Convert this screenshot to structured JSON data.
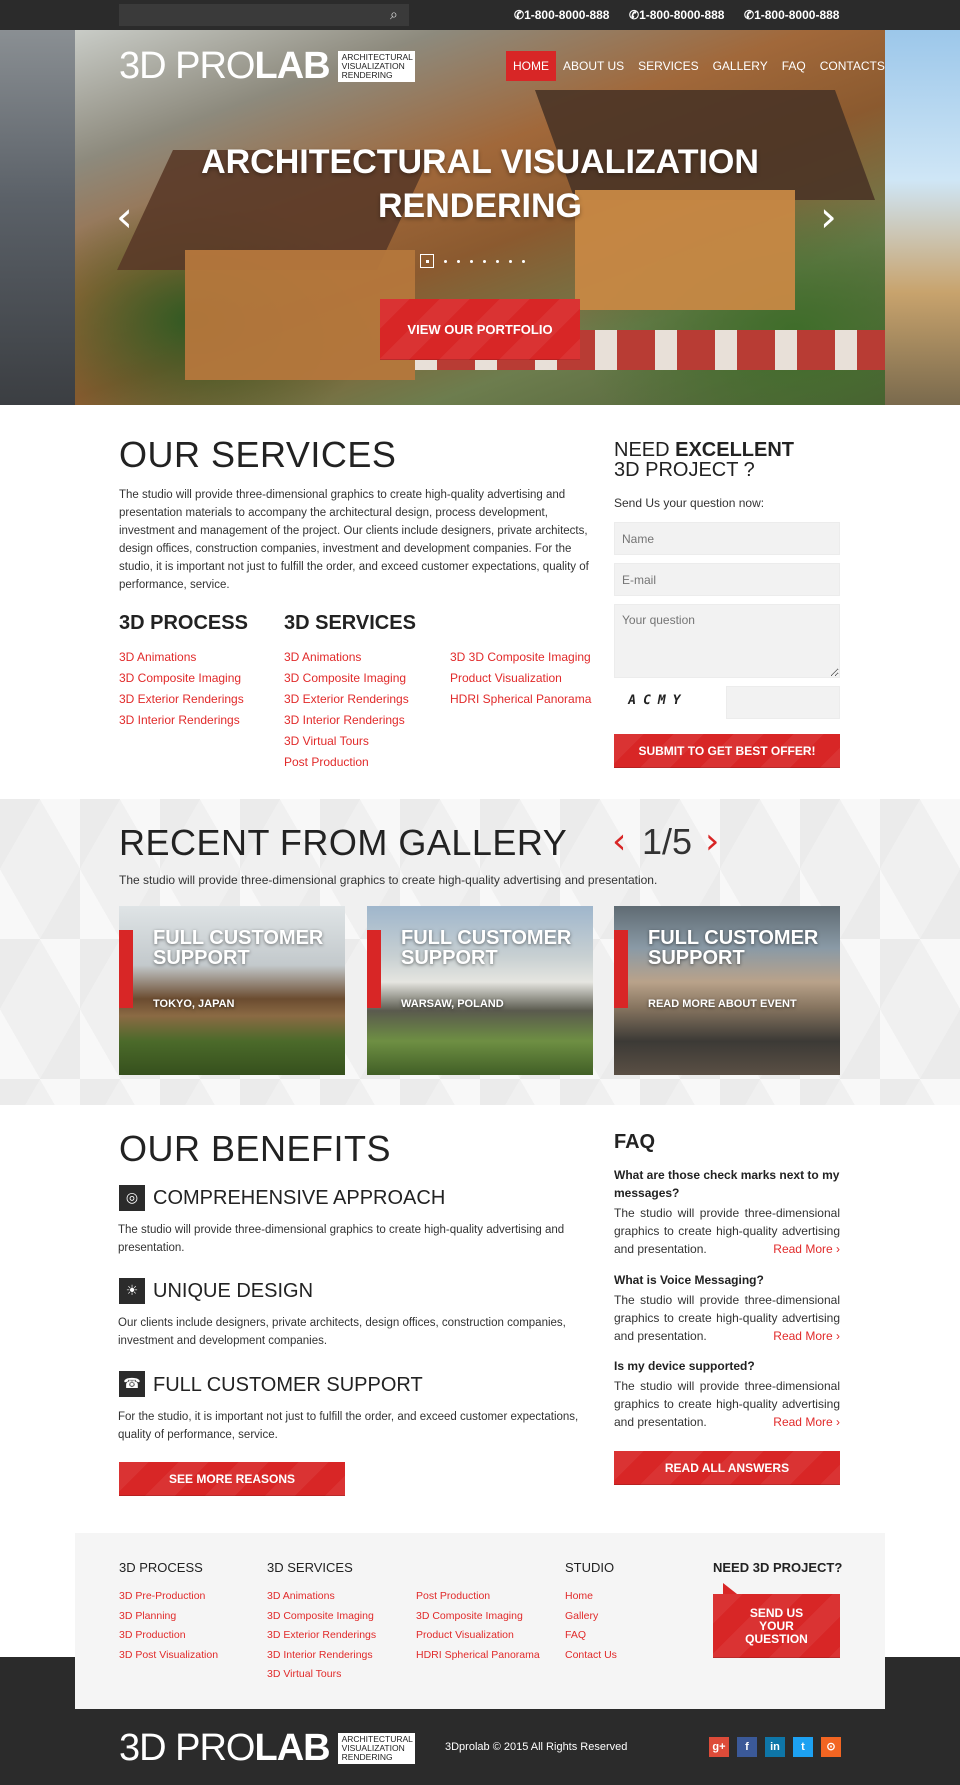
{
  "topbar": {
    "search_placeholder": "",
    "phones": [
      "1-800-8000-888",
      "1-800-8000-888",
      "1-800-8000-888"
    ]
  },
  "header": {
    "logo_main_light": "3D PRO",
    "logo_main_bold": "LAB",
    "logo_tagline": "ARCHITECTURAL VISUALIZATION RENDERING",
    "nav": [
      "HOME",
      "ABOUT US",
      "SERVICES",
      "GALLERY",
      "FAQ",
      "CONTACTS"
    ]
  },
  "hero": {
    "title": "ARCHITECTURAL VISUALIZATION RENDERING",
    "cta": "VIEW OUR PORTFOLIO",
    "slide_count": 8,
    "active_slide": 1
  },
  "services": {
    "title": "OUR SERVICES",
    "text": "The studio will provide three-dimensional graphics to create high-quality advertising and presentation materials to accompany the architectural design, process development, investment and management of the project. Our clients include designers, private architects, design offices, construction companies, investment and development companies. For the studio, it is important not just to fulfill the order, and exceed customer expectations, quality of performance, service.",
    "process_title": "3D PROCESS",
    "process_links": [
      "3D Animations",
      "3D Composite Imaging",
      "3D Exterior Renderings",
      "3D Interior Renderings"
    ],
    "services_title": "3D SERVICES",
    "services_links": [
      "3D Animations",
      "3D Composite Imaging",
      "3D Exterior Renderings",
      "3D Interior Renderings",
      "3D Virtual Tours",
      "Post Production"
    ],
    "services_links_2": [
      "3D 3D Composite Imaging",
      "Product Visualization",
      "HDRI Spherical Panorama"
    ]
  },
  "form": {
    "title_light": "NEED ",
    "title_bold": "EXCELLENT",
    "title_line2": "3D PROJECT ?",
    "label": "Send Us your question now:",
    "name_placeholder": "Name",
    "email_placeholder": "E-mail",
    "question_placeholder": "Your question",
    "captcha": "ACMY",
    "submit": "SUBMIT TO GET BEST OFFER!"
  },
  "gallery": {
    "title": "RECENT FROM GALLERY",
    "text": "The studio will provide three-dimensional graphics to create high-quality advertising and presentation.",
    "pager": "1/5",
    "cards": [
      {
        "title": "FULL CUSTOMER SUPPORT",
        "subtitle": "TOKYO, JAPAN"
      },
      {
        "title": "FULL CUSTOMER SUPPORT",
        "subtitle": "WARSAW, POLAND"
      },
      {
        "title": "FULL CUSTOMER SUPPORT",
        "subtitle": "READ MORE ABOUT EVENT"
      }
    ]
  },
  "benefits": {
    "title": "OUR BENEFITS",
    "items": [
      {
        "icon": "target-icon",
        "title": "COMPREHENSIVE APPROACH",
        "text": "The studio will provide three-dimensional graphics to create high-quality advertising and presentation."
      },
      {
        "icon": "lightbulb-icon",
        "title": "UNIQUE DESIGN",
        "text": "Our clients include designers, private architects, design offices, construction companies, investment and development companies."
      },
      {
        "icon": "phone-24-icon",
        "title": "FULL CUSTOMER SUPPORT",
        "text": "For the studio, it is important not just to fulfill the order, and exceed customer expectations, quality of performance, service."
      }
    ],
    "cta": "SEE MORE REASONS"
  },
  "faq": {
    "title": "FAQ",
    "items": [
      {
        "q": "What are those check marks next to my messages?",
        "a": "The studio will provide three-dimensional graphics to create high-quality advertising and presentation."
      },
      {
        "q": "What is Voice Messaging?",
        "a": "The studio will provide three-dimensional graphics to create high-quality advertising and presentation."
      },
      {
        "q": "Is my device supported?",
        "a": "The studio will provide three-dimensional graphics to create high-quality advertising and presentation."
      }
    ],
    "read_more": "Read More ›",
    "cta": "READ ALL ANSWERS"
  },
  "footer": {
    "process_title": "3D PROCESS",
    "process_links": [
      "3D Pre-Production",
      "3D Planning",
      "3D Production",
      "3D Post Visualization"
    ],
    "services_title": "3D SERVICES",
    "services_links": [
      "3D Animations",
      "3D Composite Imaging",
      "3D Exterior Renderings",
      "3D Interior Renderings",
      "3D Virtual Tours"
    ],
    "services_links_2": [
      "Post Production",
      "3D Composite Imaging",
      "Product Visualization",
      "HDRI Spherical Panorama"
    ],
    "studio_title": "STUDIO",
    "studio_links": [
      "Home",
      "Gallery",
      "FAQ",
      "Contact Us"
    ],
    "need_title": "NEED 3D PROJECT?",
    "ask_button": "SEND US YOUR QUESTION",
    "copyright": "3Dprolab © 2015 All Rights Reserved",
    "social": [
      {
        "icon": "google-plus-icon",
        "glyph": "g+",
        "color": "#dd4b39"
      },
      {
        "icon": "facebook-icon",
        "glyph": "f",
        "color": "#3b5998"
      },
      {
        "icon": "linkedin-icon",
        "glyph": "in",
        "color": "#0e76a8"
      },
      {
        "icon": "twitter-icon",
        "glyph": "t",
        "color": "#1da1f2"
      },
      {
        "icon": "rss-icon",
        "glyph": "⊙",
        "color": "#f26522"
      }
    ]
  },
  "colors": {
    "accent": "#d82626",
    "dark": "#2b2b2b"
  }
}
